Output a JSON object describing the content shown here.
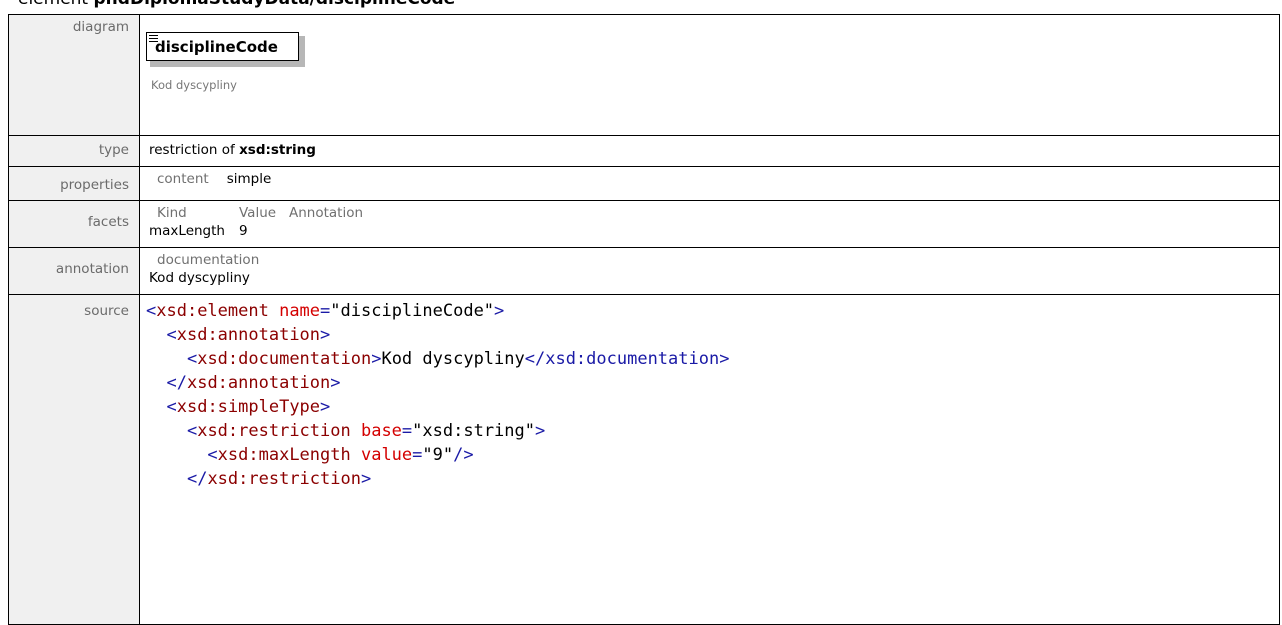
{
  "heading": {
    "prefix": "element",
    "path": "phdDiplomaStudyData/disciplineCode"
  },
  "rows": {
    "diagram_label": "diagram",
    "type_label": "type",
    "properties_label": "properties",
    "facets_label": "facets",
    "annotation_label": "annotation",
    "source_label": "source"
  },
  "diagram": {
    "node_name": "disciplineCode",
    "node_doc": "Kod dyscypliny"
  },
  "type": {
    "prefix": "restriction of",
    "base": "xsd:string"
  },
  "properties": {
    "key": "content",
    "value": "simple"
  },
  "facets": {
    "headers": [
      "Kind",
      "Value",
      "Annotation"
    ],
    "rows": [
      {
        "kind": "maxLength",
        "value": "9",
        "annotation": ""
      }
    ]
  },
  "annotation": {
    "header": "documentation",
    "text": "Kod dyscypliny"
  },
  "source": {
    "lines": [
      {
        "indent": "",
        "open": "<",
        "name": "xsd:element",
        "attr": " name",
        "eq": "=",
        "val": "\"disciplineCode\"",
        "close": ">",
        "text": "",
        "end": ""
      },
      {
        "indent": "  ",
        "open": "<",
        "name": "xsd:annotation",
        "attr": "",
        "eq": "",
        "val": "",
        "close": ">",
        "text": "",
        "end": ""
      },
      {
        "indent": "    ",
        "open": "<",
        "name": "xsd:documentation",
        "attr": "",
        "eq": "",
        "val": "",
        "close": ">",
        "text": "Kod dyscypliny",
        "end": "</xsd:documentation>"
      },
      {
        "indent": "  ",
        "open": "</",
        "name": "xsd:annotation",
        "attr": "",
        "eq": "",
        "val": "",
        "close": ">",
        "text": "",
        "end": ""
      },
      {
        "indent": "  ",
        "open": "<",
        "name": "xsd:simpleType",
        "attr": "",
        "eq": "",
        "val": "",
        "close": ">",
        "text": "",
        "end": ""
      },
      {
        "indent": "    ",
        "open": "<",
        "name": "xsd:restriction",
        "attr": " base",
        "eq": "=",
        "val": "\"xsd:string\"",
        "close": ">",
        "text": "",
        "end": ""
      },
      {
        "indent": "      ",
        "open": "<",
        "name": "xsd:maxLength",
        "attr": " value",
        "eq": "=",
        "val": "\"9\"",
        "close": "/>",
        "text": "",
        "end": ""
      },
      {
        "indent": "    ",
        "open": "</",
        "name": "xsd:restriction",
        "attr": "",
        "eq": "",
        "val": "",
        "close": ">",
        "text": "",
        "end": ""
      }
    ]
  }
}
